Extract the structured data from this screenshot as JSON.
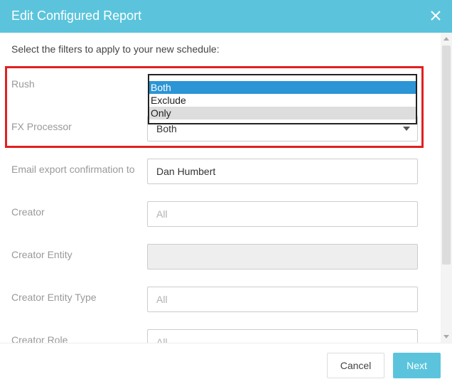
{
  "dialog": {
    "title": "Edit Configured Report",
    "intro": "Select the filters to apply to your new schedule:"
  },
  "fields": {
    "rush": {
      "label": "Rush"
    },
    "fx_processor": {
      "label": "FX Processor",
      "value": "Both"
    },
    "email_confirmation": {
      "label": "Email export confirmation to",
      "value": "Dan Humbert"
    },
    "creator": {
      "label": "Creator",
      "placeholder": "All"
    },
    "creator_entity": {
      "label": "Creator Entity",
      "value": ""
    },
    "creator_entity_type": {
      "label": "Creator Entity Type",
      "placeholder": "All"
    },
    "creator_role": {
      "label": "Creator Role",
      "placeholder": "All"
    }
  },
  "rush_dropdown": {
    "options": [
      "Both",
      "Exclude",
      "Only"
    ],
    "selected": "Both",
    "hovered": "Only"
  },
  "footer": {
    "cancel_label": "Cancel",
    "next_label": "Next"
  },
  "colors": {
    "header_bg": "#5bc4dc",
    "accent": "#5bc4dc",
    "selected_option": "#2b95d6",
    "highlight_border": "#e02020"
  },
  "icons": {
    "close": "close-icon",
    "caret": "chevron-down-icon"
  }
}
